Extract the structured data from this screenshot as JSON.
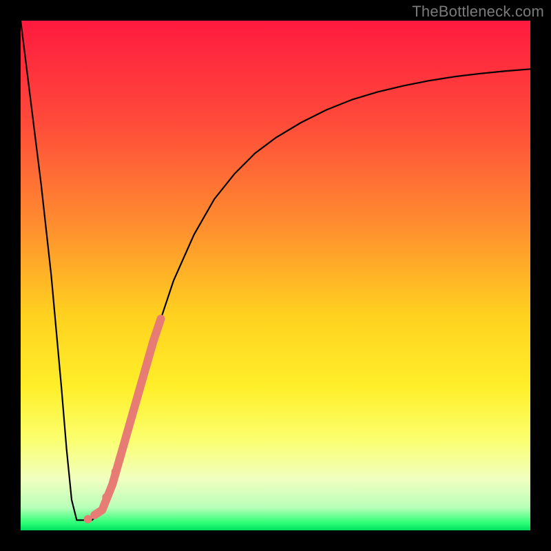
{
  "watermark": "TheBottleneck.com",
  "chart_data": {
    "type": "line",
    "title": "",
    "xlabel": "",
    "ylabel": "",
    "xlim": [
      0,
      100
    ],
    "ylim": [
      0,
      100
    ],
    "background_gradient": {
      "stops": [
        {
          "offset": 0.0,
          "color": "#ff1a3f"
        },
        {
          "offset": 0.2,
          "color": "#ff4b3a"
        },
        {
          "offset": 0.4,
          "color": "#ff8d2f"
        },
        {
          "offset": 0.58,
          "color": "#ffd21f"
        },
        {
          "offset": 0.72,
          "color": "#ffef2a"
        },
        {
          "offset": 0.82,
          "color": "#fbff6d"
        },
        {
          "offset": 0.9,
          "color": "#f0ffc0"
        },
        {
          "offset": 0.955,
          "color": "#b9ffb9"
        },
        {
          "offset": 0.985,
          "color": "#2eff76"
        },
        {
          "offset": 1.0,
          "color": "#00e060"
        }
      ]
    },
    "series": [
      {
        "name": "bottleneck-curve",
        "color": "#000000",
        "stroke_width": 2.2,
        "x": [
          0,
          2,
          4,
          6,
          7,
          8,
          9,
          10,
          11,
          12,
          14,
          16,
          18,
          20,
          22,
          24,
          26,
          28,
          30,
          34,
          38,
          42,
          46,
          50,
          55,
          60,
          65,
          70,
          75,
          80,
          85,
          90,
          95,
          100
        ],
        "y": [
          100,
          84,
          68,
          50,
          39,
          28,
          16,
          6,
          2,
          2,
          2,
          4,
          9,
          16,
          23,
          30,
          37,
          43,
          49,
          58,
          65,
          70,
          74,
          77,
          80,
          82.5,
          84.5,
          86,
          87.2,
          88.2,
          89,
          89.6,
          90.1,
          90.5
        ]
      }
    ],
    "highlight_segment": {
      "name": "highlighted-range",
      "color": "#e77c74",
      "stroke_width": 12,
      "x": [
        14.5,
        16,
        18,
        20,
        22,
        24,
        26,
        27.5
      ],
      "y": [
        3,
        4,
        9,
        16,
        23,
        30,
        37,
        41.5
      ]
    },
    "highlight_dots": {
      "name": "highlight-dots",
      "color": "#e77c74",
      "radius": 6,
      "points": [
        {
          "x": 13.2,
          "y": 2.2
        },
        {
          "x": 16.8,
          "y": 6.5
        },
        {
          "x": 18.6,
          "y": 11.5
        },
        {
          "x": 19.4,
          "y": 14.0
        }
      ]
    }
  }
}
